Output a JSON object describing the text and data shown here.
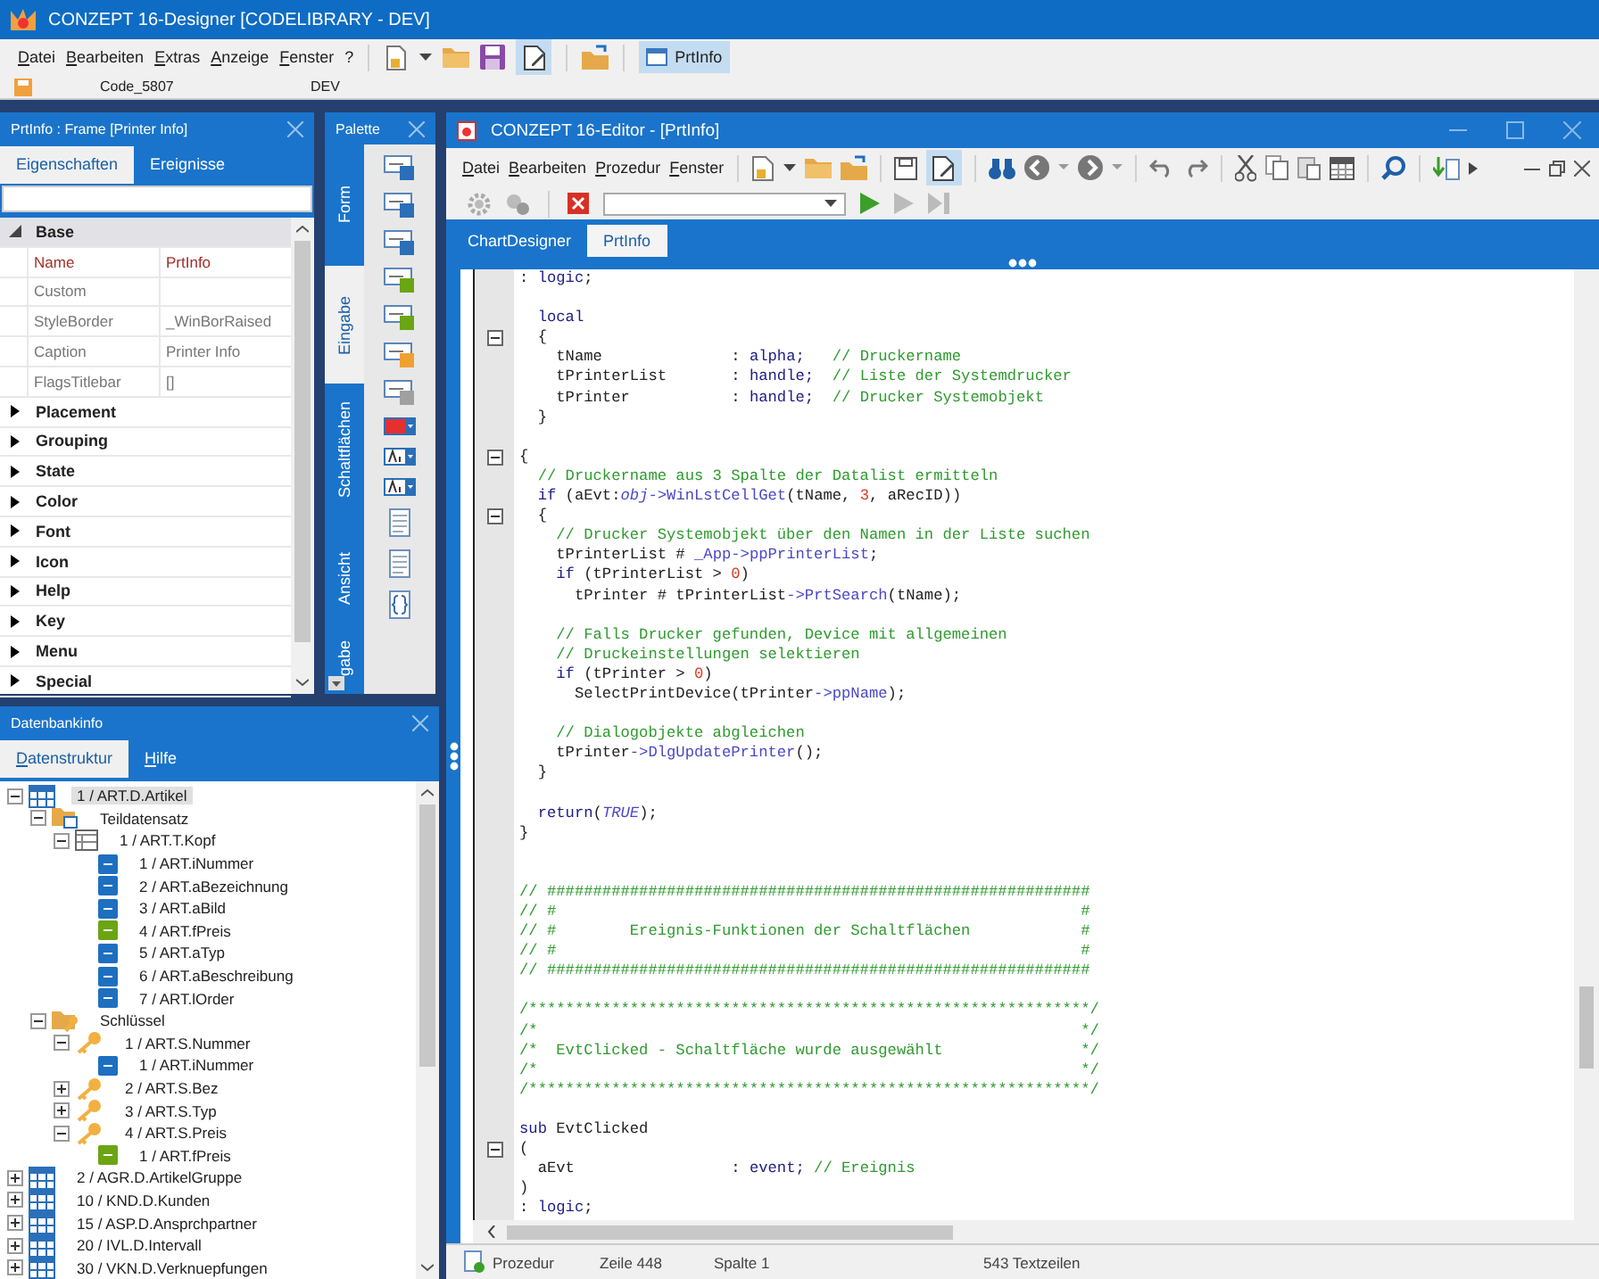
{
  "designer": {
    "title": "CONZEPT 16-Designer [CODELIBRARY - DEV]",
    "menu": [
      "Datei",
      "Bearbeiten",
      "Extras",
      "Anzeige",
      "Fenster",
      "?"
    ],
    "edit_button": {
      "pressed": true
    },
    "window_button": {
      "label": "PrtInfo",
      "pressed": true
    },
    "info": {
      "code": "Code_5807",
      "database": "DEV"
    }
  },
  "properties_panel": {
    "title": "PrtInfo : Frame [Printer Info]",
    "tabs": [
      {
        "label": "Eigenschaften",
        "selected": true
      },
      {
        "label": "Ereignisse",
        "selected": false
      }
    ],
    "rows": [
      {
        "kind": "category",
        "label": "Base",
        "expanded": true
      },
      {
        "kind": "property",
        "name": "Name",
        "value": "PrtInfo",
        "modified": true
      },
      {
        "kind": "property",
        "name": "Custom",
        "modified": false
      },
      {
        "kind": "property",
        "name": "StyleBorder",
        "value": "_WinBorRaised",
        "modified": false
      },
      {
        "kind": "property",
        "name": "Caption",
        "value": "Printer Info",
        "modified": false
      },
      {
        "kind": "property",
        "name": "FlagsTitlebar",
        "value": "[]",
        "modified": false
      },
      {
        "kind": "category",
        "label": "Placement",
        "expanded": false
      },
      {
        "kind": "category",
        "label": "Grouping",
        "expanded": false
      },
      {
        "kind": "category",
        "label": "State",
        "expanded": false
      },
      {
        "kind": "category",
        "label": "Color",
        "expanded": false
      },
      {
        "kind": "category",
        "label": "Font",
        "expanded": false
      },
      {
        "kind": "category",
        "label": "Icon",
        "expanded": false
      },
      {
        "kind": "category",
        "label": "Help",
        "expanded": false
      },
      {
        "kind": "category",
        "label": "Key",
        "expanded": false
      },
      {
        "kind": "category",
        "label": "Menu",
        "expanded": false
      },
      {
        "kind": "category",
        "label": "Special",
        "expanded": false
      }
    ]
  },
  "palette": {
    "title": "Palette",
    "tabs": [
      {
        "label": "Form",
        "selected": false
      },
      {
        "label": "Eingabe",
        "selected": true
      },
      {
        "label": "Schaltflächen",
        "selected": false
      },
      {
        "label": "Ansicht",
        "selected": false
      },
      {
        "label": "gabe",
        "selected": false
      }
    ]
  },
  "database_panel": {
    "title": "Datenbankinfo",
    "tabs": [
      {
        "label": "Datenstruktur",
        "selected": true
      },
      {
        "label": "Hilfe",
        "selected": false
      }
    ],
    "tree": [
      {
        "label": "1 / ART.D.Artikel",
        "kind": "table",
        "expanded": true,
        "selected": true,
        "children": [
          {
            "label": "Teildatensatz",
            "kind": "folder",
            "expanded": true,
            "selected": false,
            "children": [
              {
                "label": "1 / ART.T.Kopf",
                "kind": "record",
                "expanded": true,
                "selected": false,
                "children": [
                  {
                    "label": "1 / ART.iNummer",
                    "kind": "int",
                    "selected": false
                  },
                  {
                    "label": "2 / ART.aBezeichnung",
                    "kind": "alpha",
                    "selected": false
                  },
                  {
                    "label": "3 / ART.aBild",
                    "kind": "alpha",
                    "selected": false
                  },
                  {
                    "label": "4 / ART.fPreis",
                    "kind": "float",
                    "selected": false
                  },
                  {
                    "label": "5 / ART.aTyp",
                    "kind": "alpha",
                    "selected": false
                  },
                  {
                    "label": "6 / ART.aBeschreibung",
                    "kind": "alpha",
                    "selected": false
                  },
                  {
                    "label": "7 / ART.lOrder",
                    "kind": "order",
                    "selected": false
                  }
                ]
              }
            ]
          },
          {
            "label": "Schlüssel",
            "kind": "key-folder",
            "expanded": true,
            "selected": false,
            "children": [
              {
                "label": "1 / ART.S.Nummer",
                "kind": "key",
                "expanded": true,
                "selected": false,
                "children": [
                  {
                    "label": "1 / ART.iNummer",
                    "kind": "int",
                    "selected": false
                  }
                ]
              },
              {
                "label": "2 / ART.S.Bez",
                "kind": "key",
                "expanded": false,
                "selected": false
              },
              {
                "label": "3 / ART.S.Typ",
                "kind": "key",
                "expanded": false,
                "selected": false
              },
              {
                "label": "4 / ART.S.Preis",
                "kind": "key",
                "expanded": true,
                "selected": false,
                "children": [
                  {
                    "label": "1 / ART.fPreis",
                    "kind": "float",
                    "selected": false
                  }
                ]
              }
            ]
          }
        ]
      },
      {
        "label": "2 / AGR.D.ArtikelGruppe",
        "kind": "table",
        "expanded": false,
        "selected": false
      },
      {
        "label": "10 / KND.D.Kunden",
        "kind": "table",
        "expanded": false,
        "selected": false
      },
      {
        "label": "15 / ASP.D.Ansprchpartner",
        "kind": "table",
        "expanded": false,
        "selected": false
      },
      {
        "label": "20 / IVL.D.Intervall",
        "kind": "table",
        "expanded": false,
        "selected": false
      },
      {
        "label": "30 / VKN.D.Verknuepfungen",
        "kind": "table",
        "expanded": false,
        "selected": false
      }
    ]
  },
  "editor": {
    "title": "CONZEPT 16-Editor - [PrtInfo]",
    "menu": [
      "Datei",
      "Bearbeiten",
      "Prozedur",
      "Fenster"
    ],
    "edit_button": {
      "pressed": true
    },
    "tabs": [
      {
        "label": "ChartDesigner",
        "selected": false
      },
      {
        "label": "PrtInfo",
        "selected": true
      }
    ],
    "lines": [
      {
        "kind": "code",
        "parts": [
          {
            "kind": "text",
            "text": ": "
          },
          {
            "kind": "keyword",
            "text": "logic"
          },
          {
            "kind": "text",
            "text": ";"
          }
        ]
      },
      {
        "kind": "blank"
      },
      {
        "kind": "code",
        "parts": [
          {
            "kind": "keyword",
            "text": "  local"
          }
        ]
      },
      {
        "kind": "code",
        "fold": true,
        "parts": [
          {
            "kind": "text",
            "text": "  {"
          }
        ]
      },
      {
        "kind": "code",
        "parts": [
          {
            "kind": "text",
            "text": "    tName              : "
          },
          {
            "kind": "keyword",
            "text": "alpha;"
          },
          {
            "kind": "comment",
            "text": "   // Druckername"
          }
        ]
      },
      {
        "kind": "code",
        "parts": [
          {
            "kind": "text",
            "text": "    tPrinterList       : "
          },
          {
            "kind": "keyword",
            "text": "handle;"
          },
          {
            "kind": "comment",
            "text": "  // Liste der Systemdrucker"
          }
        ]
      },
      {
        "kind": "code",
        "parts": [
          {
            "kind": "text",
            "text": "    tPrinter           : "
          },
          {
            "kind": "keyword",
            "text": "handle;"
          },
          {
            "kind": "comment",
            "text": "  // Drucker Systemobjekt"
          }
        ]
      },
      {
        "kind": "code",
        "parts": [
          {
            "kind": "text",
            "text": "  }"
          }
        ]
      },
      {
        "kind": "blank"
      },
      {
        "kind": "code",
        "fold": true,
        "parts": [
          {
            "kind": "text",
            "text": "{"
          }
        ]
      },
      {
        "kind": "code",
        "parts": [
          {
            "kind": "comment",
            "text": "  // Druckername aus 3 Spalte der Datalist ermitteln"
          }
        ]
      },
      {
        "kind": "code",
        "parts": [
          {
            "kind": "keyword",
            "text": "  if"
          },
          {
            "kind": "text",
            "text": " (aEvt:"
          },
          {
            "kind": "property",
            "text": "obj"
          },
          {
            "kind": "member",
            "text": "->WinLstCellGet"
          },
          {
            "kind": "text",
            "text": "(tName, "
          },
          {
            "kind": "number",
            "text": "3"
          },
          {
            "kind": "text",
            "text": ", aRecID))"
          }
        ]
      },
      {
        "kind": "code",
        "fold": true,
        "parts": [
          {
            "kind": "text",
            "text": "  {"
          }
        ]
      },
      {
        "kind": "code",
        "parts": [
          {
            "kind": "comment",
            "text": "    // Drucker Systemobjekt über den Namen in der Liste suchen"
          }
        ]
      },
      {
        "kind": "code",
        "parts": [
          {
            "kind": "text",
            "text": "    tPrinterList # "
          },
          {
            "kind": "member",
            "text": "_App->ppPrinterList"
          },
          {
            "kind": "text",
            "text": ";"
          }
        ]
      },
      {
        "kind": "code",
        "parts": [
          {
            "kind": "keyword",
            "text": "    if"
          },
          {
            "kind": "text",
            "text": " (tPrinterList > "
          },
          {
            "kind": "number",
            "text": "0"
          },
          {
            "kind": "text",
            "text": ")"
          }
        ]
      },
      {
        "kind": "code",
        "parts": [
          {
            "kind": "text",
            "text": "      tPrinter # tPrinterList"
          },
          {
            "kind": "member",
            "text": "->PrtSearch"
          },
          {
            "kind": "text",
            "text": "(tName);"
          }
        ]
      },
      {
        "kind": "blank"
      },
      {
        "kind": "code",
        "parts": [
          {
            "kind": "comment",
            "text": "    // Falls Drucker gefunden, Device mit allgemeinen"
          }
        ]
      },
      {
        "kind": "code",
        "parts": [
          {
            "kind": "comment",
            "text": "    // Druckeinstellungen selektieren"
          }
        ]
      },
      {
        "kind": "code",
        "parts": [
          {
            "kind": "keyword",
            "text": "    if"
          },
          {
            "kind": "text",
            "text": " (tPrinter > "
          },
          {
            "kind": "number",
            "text": "0"
          },
          {
            "kind": "text",
            "text": ")"
          }
        ]
      },
      {
        "kind": "code",
        "parts": [
          {
            "kind": "text",
            "text": "      SelectPrintDevice(tPrinter"
          },
          {
            "kind": "member",
            "text": "->ppName"
          },
          {
            "kind": "text",
            "text": ");"
          }
        ]
      },
      {
        "kind": "blank"
      },
      {
        "kind": "code",
        "parts": [
          {
            "kind": "comment",
            "text": "    // Dialogobjekte abgleichen"
          }
        ]
      },
      {
        "kind": "code",
        "parts": [
          {
            "kind": "text",
            "text": "    tPrinter"
          },
          {
            "kind": "member",
            "text": "->DlgUpdatePrinter"
          },
          {
            "kind": "text",
            "text": "();"
          }
        ]
      },
      {
        "kind": "code",
        "parts": [
          {
            "kind": "text",
            "text": "  }"
          }
        ]
      },
      {
        "kind": "blank"
      },
      {
        "kind": "code",
        "parts": [
          {
            "kind": "keyword",
            "text": "  return"
          },
          {
            "kind": "text",
            "text": "("
          },
          {
            "kind": "property",
            "text": "TRUE"
          },
          {
            "kind": "text",
            "text": ");"
          }
        ]
      },
      {
        "kind": "code",
        "parts": [
          {
            "kind": "text",
            "text": "}"
          }
        ]
      },
      {
        "kind": "blank"
      },
      {
        "kind": "blank"
      },
      {
        "kind": "code",
        "parts": [
          {
            "kind": "comment",
            "text": "// ###########################################################"
          }
        ]
      },
      {
        "kind": "code",
        "parts": [
          {
            "kind": "comment",
            "text": "// #                                                         #"
          }
        ]
      },
      {
        "kind": "code",
        "parts": [
          {
            "kind": "comment",
            "text": "// #        Ereignis-Funktionen der Schaltflächen            #"
          }
        ]
      },
      {
        "kind": "code",
        "parts": [
          {
            "kind": "comment",
            "text": "// #                                                         #"
          }
        ]
      },
      {
        "kind": "code",
        "parts": [
          {
            "kind": "comment",
            "text": "// ###########################################################"
          }
        ]
      },
      {
        "kind": "blank"
      },
      {
        "kind": "code",
        "parts": [
          {
            "kind": "comment",
            "text": "/*************************************************************/"
          }
        ]
      },
      {
        "kind": "code",
        "parts": [
          {
            "kind": "comment",
            "text": "/*                                                           */"
          }
        ]
      },
      {
        "kind": "code",
        "parts": [
          {
            "kind": "comment",
            "text": "/*  EvtClicked - Schaltfläche wurde ausgewählt               */"
          }
        ]
      },
      {
        "kind": "code",
        "parts": [
          {
            "kind": "comment",
            "text": "/*                                                           */"
          }
        ]
      },
      {
        "kind": "code",
        "parts": [
          {
            "kind": "comment",
            "text": "/*************************************************************/"
          }
        ]
      },
      {
        "kind": "blank"
      },
      {
        "kind": "code",
        "parts": [
          {
            "kind": "keyword",
            "text": "sub"
          },
          {
            "kind": "text",
            "text": " EvtClicked"
          }
        ]
      },
      {
        "kind": "code",
        "fold": true,
        "parts": [
          {
            "kind": "text",
            "text": "("
          }
        ]
      },
      {
        "kind": "code",
        "parts": [
          {
            "kind": "text",
            "text": "  aEvt                 : "
          },
          {
            "kind": "keyword",
            "text": "event;"
          },
          {
            "kind": "comment",
            "text": " // Ereignis"
          }
        ]
      },
      {
        "kind": "code",
        "parts": [
          {
            "kind": "text",
            "text": ")"
          }
        ]
      },
      {
        "kind": "code",
        "parts": [
          {
            "kind": "text",
            "text": ": "
          },
          {
            "kind": "keyword",
            "text": "logic"
          },
          {
            "kind": "text",
            "text": ";"
          }
        ]
      }
    ],
    "status": {
      "mode": "Prozedur",
      "line": "Zeile 448",
      "column": "Spalte 1",
      "total": "543 Textzeilen"
    }
  }
}
